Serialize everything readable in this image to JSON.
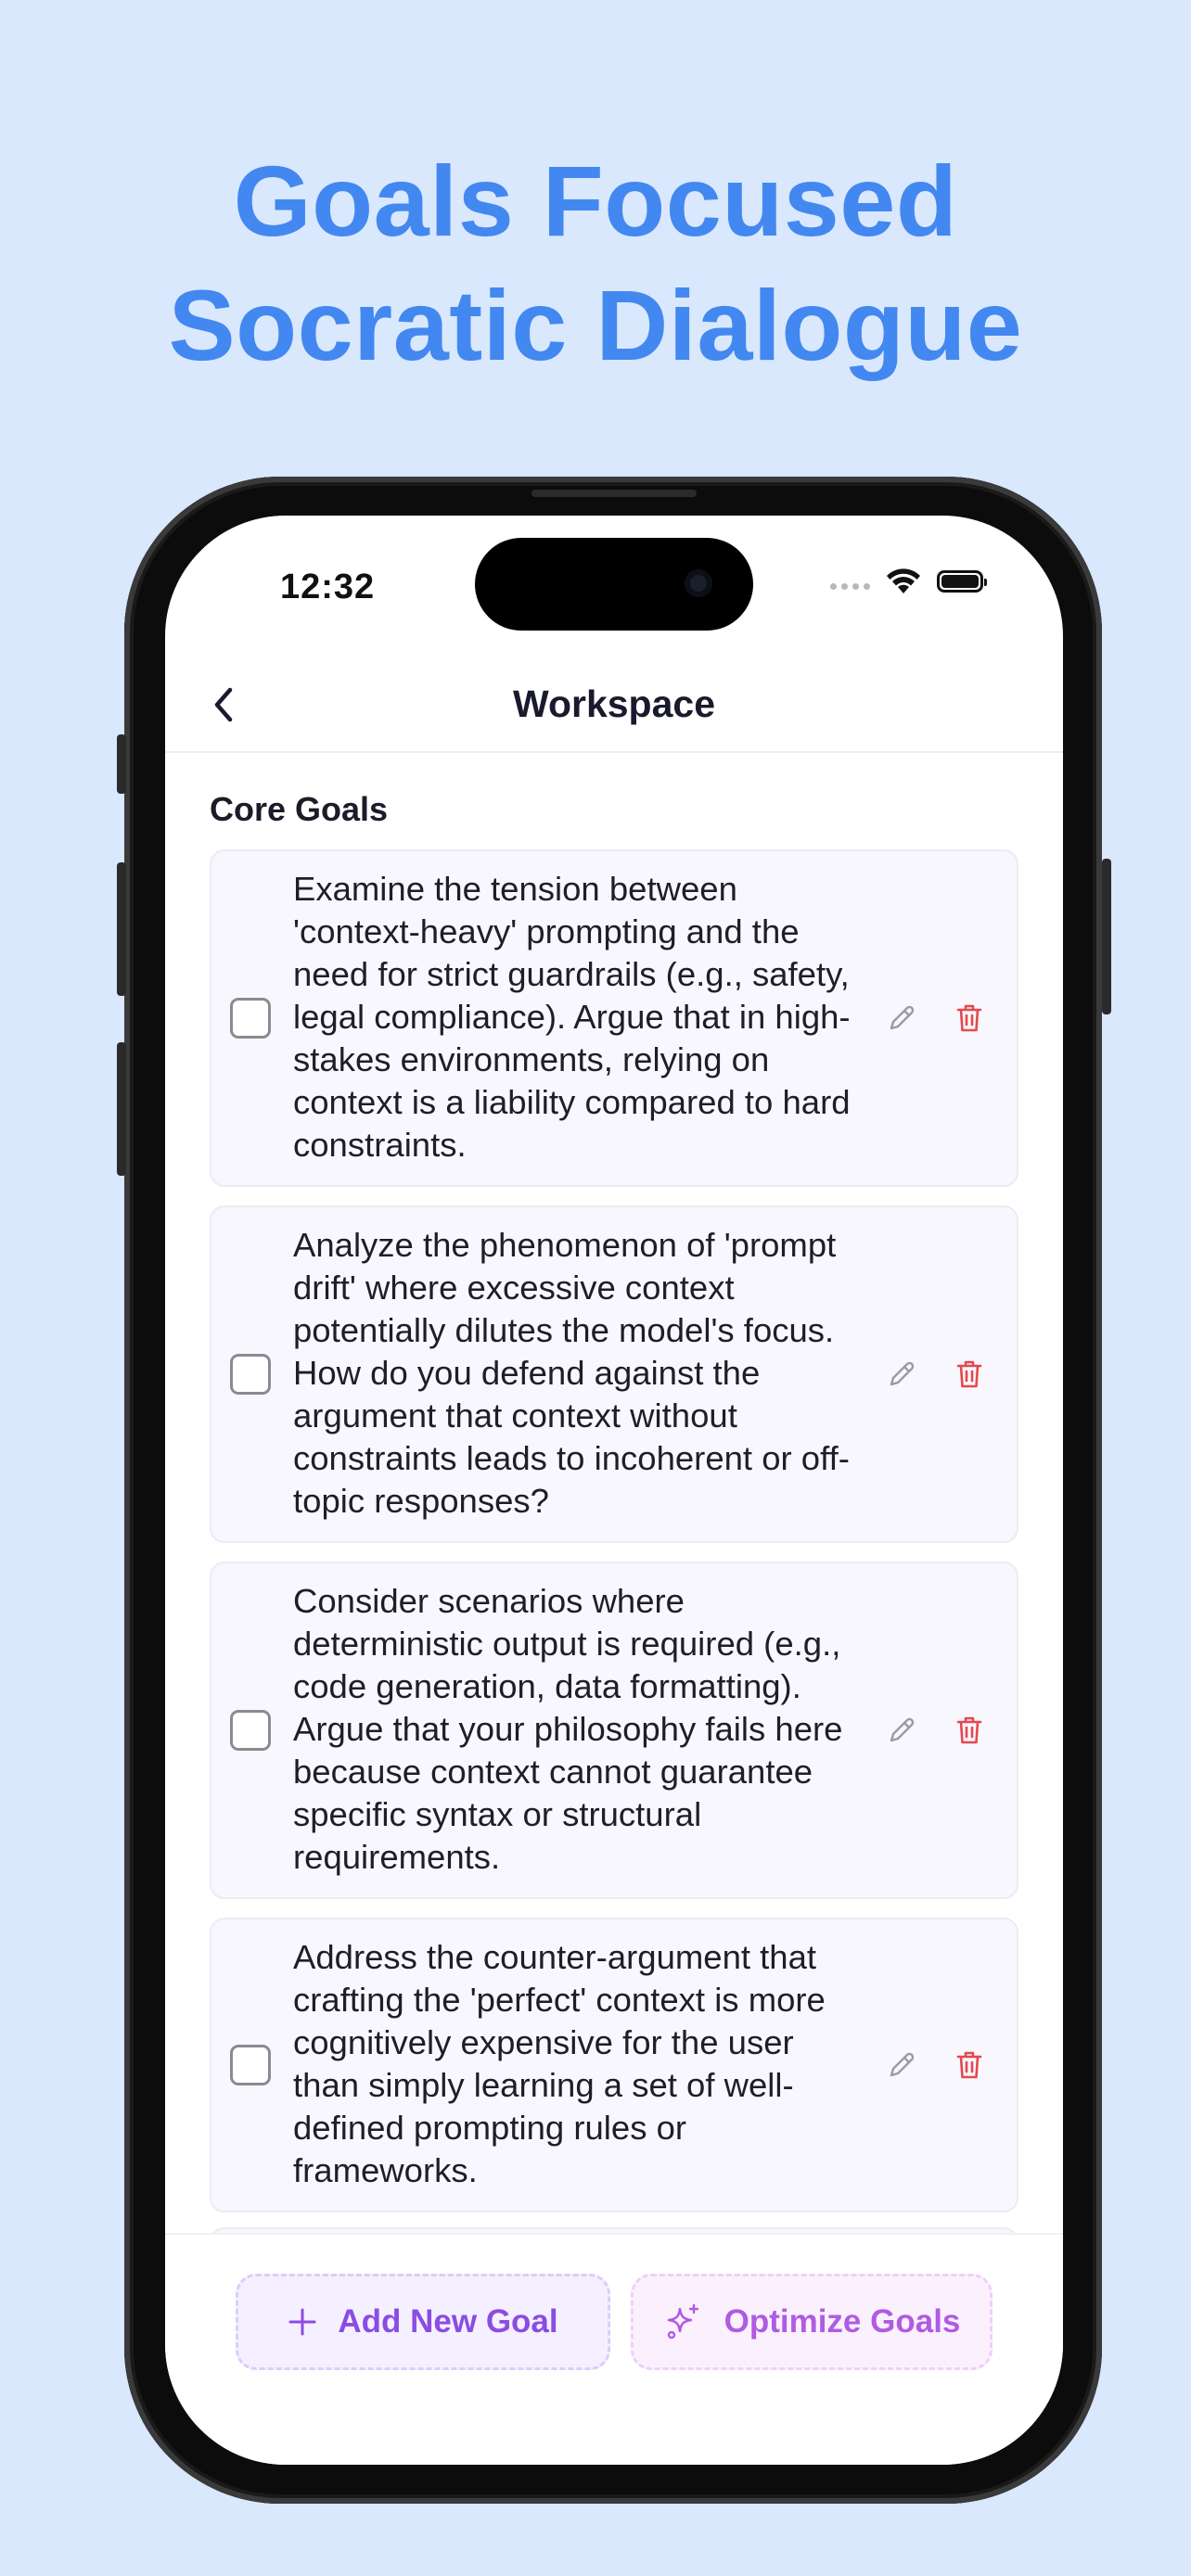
{
  "headline": {
    "line1": "Goals Focused",
    "line2": "Socratic Dialogue"
  },
  "status_bar": {
    "time": "12:32",
    "icons": [
      "signal-dots-icon",
      "wifi-icon",
      "battery-icon"
    ]
  },
  "navbar": {
    "title": "Workspace",
    "back_icon": "chevron-left-icon"
  },
  "section": {
    "title": "Core Goals"
  },
  "goals": [
    {
      "checked": false,
      "text": "Examine the tension between 'context-heavy' prompting and the need for strict guardrails (e.g., safety, legal compliance). Argue that in high-stakes environments, relying on context is a liability compared to hard constraints."
    },
    {
      "checked": false,
      "text": "Analyze the phenomenon of 'prompt drift' where excessive context potentially dilutes the model's focus. How do you defend against the argument that context without constraints leads to incoherent or off-topic responses?"
    },
    {
      "checked": false,
      "text": "Consider scenarios where deterministic output is required (e.g., code generation, data formatting). Argue that your philosophy fails here because context cannot guarantee specific syntax or structural requirements."
    },
    {
      "checked": false,
      "text": "Address the counter-argument that crafting the 'perfect' context is more cognitively expensive for the user than simply learning a set of well-defined prompting rules or frameworks."
    }
  ],
  "actions": {
    "add_label": "Add New Goal",
    "optimize_label": "Optimize Goals"
  },
  "colors": {
    "background": "#d9e8fd",
    "headline": "#4388f0",
    "accent_purple": "#8b4ce3",
    "delete_red": "#e5484d"
  }
}
